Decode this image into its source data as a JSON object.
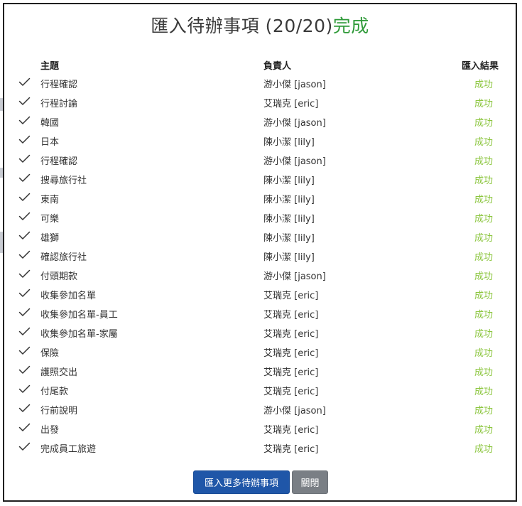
{
  "dialog": {
    "title": "匯入待辦事項 (20/20)",
    "status": "完成",
    "status_color": "#2e9a38"
  },
  "table": {
    "headers": {
      "subject": "主題",
      "owner": "負責人",
      "result": "匯入結果"
    },
    "rows": [
      {
        "subject": "行程確認",
        "owner": "游小傑 [jason]",
        "result": "成功"
      },
      {
        "subject": "行程討論",
        "owner": "艾瑞克 [eric]",
        "result": "成功"
      },
      {
        "subject": "韓國",
        "owner": "游小傑 [jason]",
        "result": "成功"
      },
      {
        "subject": "日本",
        "owner": "陳小潔 [lily]",
        "result": "成功"
      },
      {
        "subject": "行程確認",
        "owner": "游小傑 [jason]",
        "result": "成功"
      },
      {
        "subject": "搜尋旅行社",
        "owner": "陳小潔 [lily]",
        "result": "成功"
      },
      {
        "subject": "東南",
        "owner": "陳小潔 [lily]",
        "result": "成功"
      },
      {
        "subject": "可樂",
        "owner": "陳小潔 [lily]",
        "result": "成功"
      },
      {
        "subject": "雄獅",
        "owner": "陳小潔 [lily]",
        "result": "成功"
      },
      {
        "subject": "確認旅行社",
        "owner": "陳小潔 [lily]",
        "result": "成功"
      },
      {
        "subject": "付頭期款",
        "owner": "游小傑 [jason]",
        "result": "成功"
      },
      {
        "subject": "收集參加名單",
        "owner": "艾瑞克 [eric]",
        "result": "成功"
      },
      {
        "subject": "收集參加名單-員工",
        "owner": "艾瑞克 [eric]",
        "result": "成功"
      },
      {
        "subject": "收集參加名單-家屬",
        "owner": "艾瑞克 [eric]",
        "result": "成功"
      },
      {
        "subject": "保險",
        "owner": "艾瑞克 [eric]",
        "result": "成功"
      },
      {
        "subject": "護照交出",
        "owner": "艾瑞克 [eric]",
        "result": "成功"
      },
      {
        "subject": "付尾款",
        "owner": "艾瑞克 [eric]",
        "result": "成功"
      },
      {
        "subject": "行前說明",
        "owner": "游小傑 [jason]",
        "result": "成功"
      },
      {
        "subject": "出發",
        "owner": "艾瑞克 [eric]",
        "result": "成功"
      },
      {
        "subject": "完成員工旅遊",
        "owner": "艾瑞克 [eric]",
        "result": "成功"
      }
    ],
    "row_icon": "check-icon",
    "success_color": "#8cc63f"
  },
  "footer": {
    "import_more_label": "匯入更多待辦事項",
    "close_label": "關閉",
    "primary_color": "#1f56a8",
    "secondary_color": "#7a7f85"
  }
}
